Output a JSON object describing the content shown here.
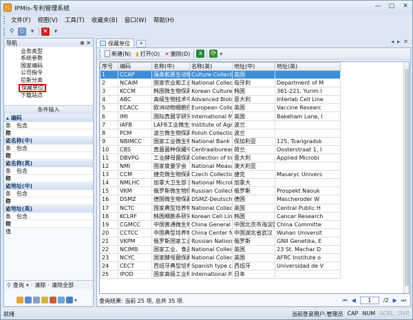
{
  "window": {
    "title": "IPMis-专利管理系统",
    "controls": [
      "—",
      "□",
      "✕"
    ]
  },
  "menu": [
    "文件(F)",
    "视图(V)",
    "工具(T)",
    "收藏夹(B)",
    "窗口(W)",
    "帮助(H)"
  ],
  "left": {
    "header": "导航",
    "pin": "⊕ ✕",
    "nav_items": [
      "业务类型",
      "系统参数",
      "国家编码",
      "公司指令",
      "尼斯分类",
      "保藏单位",
      "下载站点"
    ],
    "selected_nav_index": 5,
    "conditions_title": "条件输入",
    "groups": [
      {
        "title": "编码",
        "rows": [
          {
            "k": "条件",
            "v": "包含"
          },
          {
            "k": "取值",
            "v": ""
          }
        ]
      },
      {
        "title": "名称(中)",
        "rows": [
          {
            "k": "条件",
            "v": "包含"
          },
          {
            "k": "取值",
            "v": ""
          }
        ]
      },
      {
        "title": "名称(英)",
        "rows": [
          {
            "k": "条件",
            "v": "包含"
          },
          {
            "k": "取值",
            "v": ""
          }
        ]
      },
      {
        "title": "地址(中)",
        "rows": [
          {
            "k": "条件",
            "v": "包含"
          },
          {
            "k": "取值",
            "v": ""
          }
        ]
      },
      {
        "title": "地址(英)",
        "rows": [
          {
            "k": "条件",
            "v": "包含"
          },
          {
            "k": "取值",
            "v": ""
          }
        ]
      }
    ],
    "query_label": "查询",
    "clear_label": "清除",
    "clear_all_label": "清除全部"
  },
  "tab": {
    "label": "保藏单位"
  },
  "toolbar": {
    "new": "新建(N)",
    "open": "打开(O)",
    "delete": "删除(D)"
  },
  "grid": {
    "columns": [
      "序号",
      "编码",
      "名称(中)",
      "名称(英)",
      "地址(中)",
      "地址(英)"
    ],
    "selected_row": 0,
    "rows": [
      [
        "1",
        "CCAP",
        "藻类和原生动物保",
        "Culture Collectic",
        "英国",
        ""
      ],
      [
        "2",
        "NCAIM",
        "国家农业和工业微",
        "National Collecti",
        "匈牙利",
        "Department of M"
      ],
      [
        "3",
        "KCCM",
        "韩国微生物保藏中",
        "Korean Culture C",
        "韩国",
        "361-221, Yurim I"
      ],
      [
        "4",
        "ABC",
        "高级生物技术中心",
        "Advanced Bioteci",
        "意大利",
        "Interlab Cell Line"
      ],
      [
        "5",
        "ECACC",
        "欧洲动物细胞保藏",
        "European Collecti",
        "英国",
        "Vaccine Researc"
      ],
      [
        "6",
        "IMI",
        "国际真菌学研究所",
        "International Myc",
        "英国",
        "Bakeham Lane, I"
      ],
      [
        "7",
        "IAFB",
        "LAFB工业微生物保",
        "Institute of Agric",
        "波兰",
        ""
      ],
      [
        "8",
        "PCM",
        "波兰微生物保藏中",
        "Polish Collection",
        "波兰",
        ""
      ],
      [
        "9",
        "NBIMCC",
        "国家工业微生物和",
        "National Bank fo",
        "保加利亚",
        "125, Tsarigradsk"
      ],
      [
        "10",
        "CBS",
        "真菌菌种保藏中心",
        "Centraalbureau",
        "荷兰",
        "Oosterstraat 1, I"
      ],
      [
        "11",
        "DBVPG",
        "工业酵母菌保藏中",
        "Collection of Ind",
        "意大利",
        "Applied Microbi"
      ],
      [
        "12",
        "NMI",
        "国家度量学会",
        "National Measur",
        "澳大利亚",
        ""
      ],
      [
        "13",
        "CCM",
        "捷克微生物保藏中",
        "Czech Collection",
        "捷克",
        "Masaryc Univers"
      ],
      [
        "14",
        "NMLHC",
        "加拿大卫生部 国家",
        "National Microb",
        "加拿大",
        ""
      ],
      [
        "15",
        "VKM",
        "俄罗斯微生物保藏",
        "Russian Collectic",
        "俄罗斯",
        "Prospekt Naouk"
      ],
      [
        "16",
        "DSMZ",
        "德国微生物保藏中",
        "DSMZ-Deutsche",
        "德国",
        "Mascheroder W"
      ],
      [
        "17",
        "NCTC",
        "国家典型培养物保",
        "National Collecti",
        "英国",
        "Central Public H"
      ],
      [
        "18",
        "KCLRF",
        "韩国细胞系研究基",
        "Korean Cell Line",
        "韩国",
        "Cancer Research"
      ],
      [
        "19",
        "CGMCC",
        "中国普通微生物菌",
        "China General M",
        "中国北京市海淀区",
        "China Committe"
      ],
      [
        "20",
        "CCTCC",
        "中国典型培养物保",
        "China Center for",
        "中国湖北省武汉",
        "Wuhan Universit"
      ],
      [
        "21",
        "VKPM",
        "俄罗斯国家工业微",
        "Russian Nationa",
        "俄罗斯",
        "GNII Genetika, E"
      ],
      [
        "22",
        "NCIMB",
        "国家工业、食品和",
        "National Collecti",
        "英国",
        "23 St. Machar D"
      ],
      [
        "23",
        "NCYC",
        "国家酵母菌保藏中",
        "National Collecti",
        "英国",
        "AFRC Institute o"
      ],
      [
        "24",
        "CECT",
        "西班牙典型培养物",
        "Spanish type cul",
        "西班牙",
        "Universidad de V"
      ],
      [
        "25",
        "IPOD",
        "国家高级工业科学",
        "International Pat",
        "日本",
        ""
      ]
    ]
  },
  "status": {
    "result": "查询结果: 当前 25 项, 总共 35 项.",
    "page": "1",
    "page_total": "/2"
  },
  "bottombar": {
    "left": "就绪",
    "user": "当前登录用户:管理员",
    "caps": "CAP",
    "num": "NUM",
    "scrl": "SCRL",
    "ovr": "OVR"
  }
}
